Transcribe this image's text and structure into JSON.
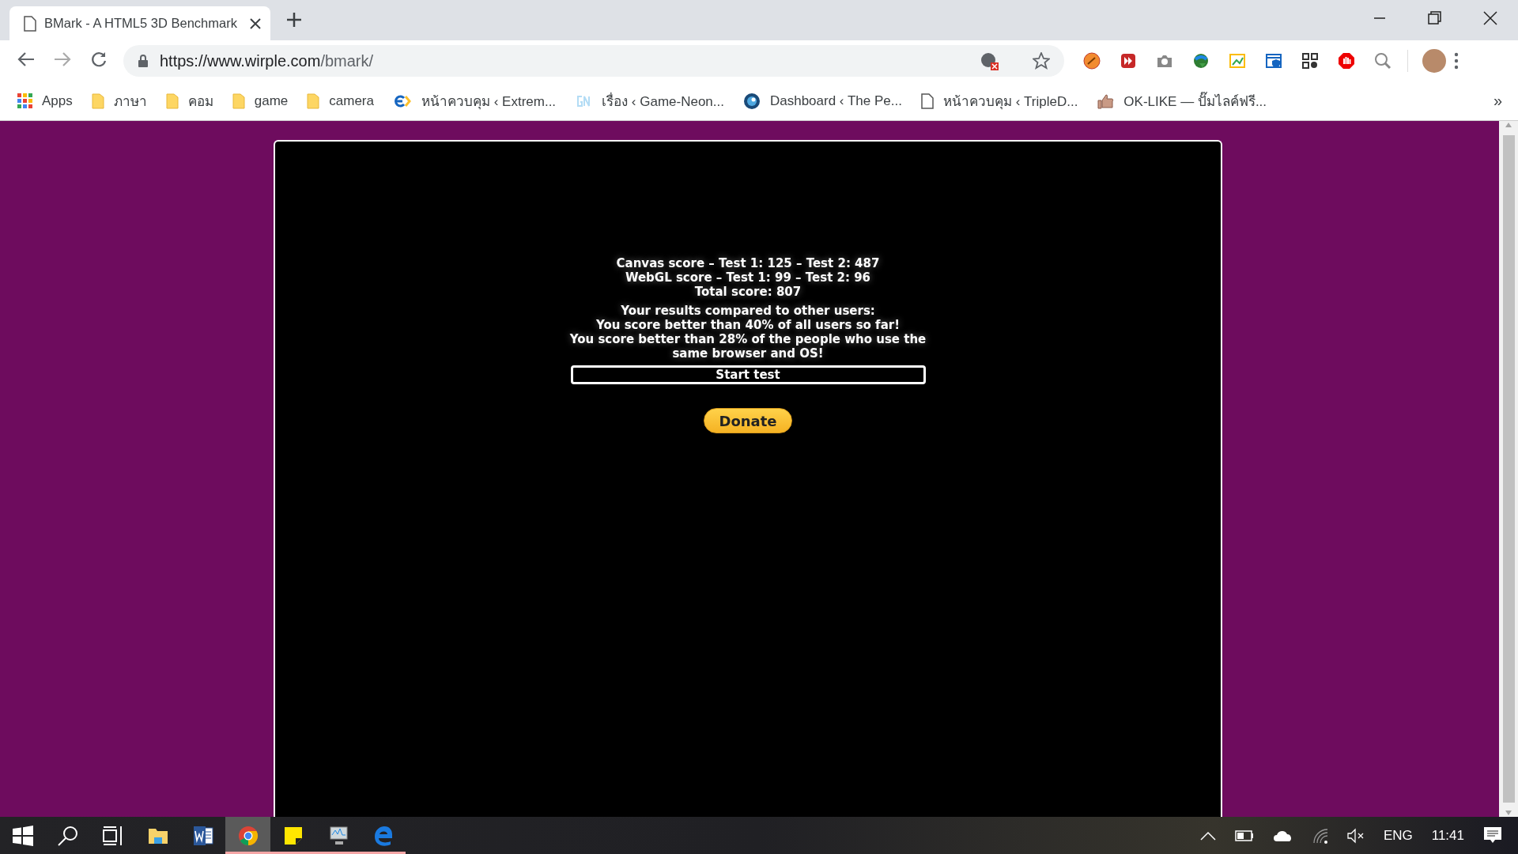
{
  "tab": {
    "title": "BMark - A HTML5 3D Benchmark",
    "selected": true
  },
  "address": {
    "scheme_host": "https://www.wirple.com",
    "path": "/bmark/"
  },
  "bookmarks": [
    {
      "kind": "apps",
      "label": "Apps"
    },
    {
      "kind": "folder",
      "label": "ภาษา"
    },
    {
      "kind": "folder",
      "label": "คอม"
    },
    {
      "kind": "folder",
      "label": "game"
    },
    {
      "kind": "folder",
      "label": "camera"
    },
    {
      "kind": "e",
      "label": "หน้าควบคุม ‹ Extrem..."
    },
    {
      "kind": "gn",
      "label": "เรื่อง ‹ Game-Neon..."
    },
    {
      "kind": "disc",
      "label": "Dashboard ‹ The Pe..."
    },
    {
      "kind": "page",
      "label": "หน้าควบคุม ‹ TripleD..."
    },
    {
      "kind": "thumb",
      "label": "OK-LIKE — ปั๊มไลค์ฟรี..."
    }
  ],
  "bookmarks_more": "»",
  "results": {
    "scores": [
      "Canvas score – Test 1: 125 – Test 2: 487",
      "WebGL score – Test 1: 99 – Test 2: 96",
      "Total score: 807"
    ],
    "comparison": [
      "Your results compared to other users:",
      "You score better than 40% of all users so far!",
      "You score better than 28% of the people who use the same browser and OS!"
    ],
    "start_button": "Start test",
    "donate_button": "Donate"
  },
  "taskbar": {
    "apps": [
      {
        "kind": "start",
        "running": false,
        "selected": false
      },
      {
        "kind": "search",
        "running": false,
        "selected": false
      },
      {
        "kind": "taskview",
        "running": false,
        "selected": false
      },
      {
        "kind": "explorer",
        "running": false,
        "selected": false
      },
      {
        "kind": "word",
        "running": false,
        "selected": false
      },
      {
        "kind": "chrome",
        "running": true,
        "selected": true
      },
      {
        "kind": "notes",
        "running": true,
        "selected": false
      },
      {
        "kind": "monitor",
        "running": true,
        "selected": false
      },
      {
        "kind": "edge",
        "running": true,
        "selected": false
      }
    ],
    "language": "ENG",
    "time": "11:41"
  }
}
